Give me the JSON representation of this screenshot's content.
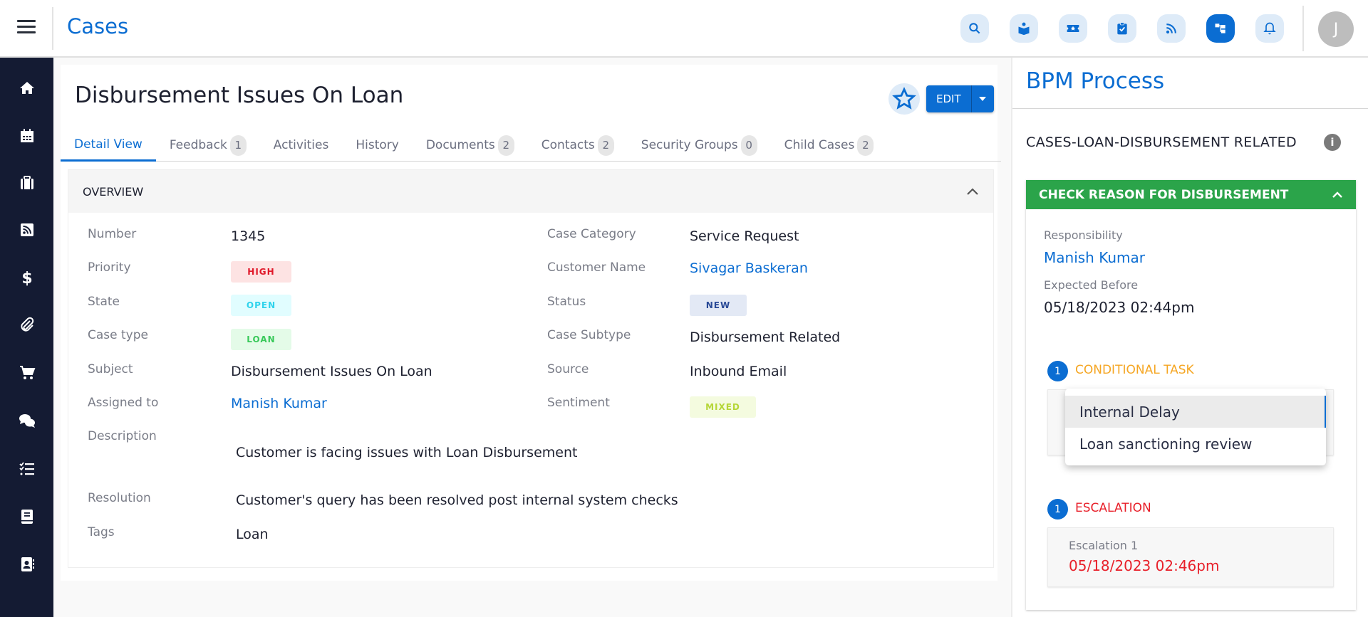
{
  "header": {
    "menu_icon": "hamburger-icon",
    "title": "Cases",
    "icons": [
      {
        "name": "search-icon",
        "active": false
      },
      {
        "name": "knowledge-base-icon",
        "active": false
      },
      {
        "name": "ticket-star-icon",
        "active": false
      },
      {
        "name": "clipboard-check-icon",
        "active": false
      },
      {
        "name": "rss-feed-icon",
        "active": false
      },
      {
        "name": "bpm-process-icon",
        "active": true
      },
      {
        "name": "bell-icon",
        "active": false
      }
    ],
    "avatar_initial": "J"
  },
  "sidebar": {
    "items": [
      {
        "name": "home-icon"
      },
      {
        "name": "calendar-icon"
      },
      {
        "name": "briefcase-icon"
      },
      {
        "name": "rss-icon"
      },
      {
        "name": "dollar-icon"
      },
      {
        "name": "paperclip-icon"
      },
      {
        "name": "cart-icon"
      },
      {
        "name": "chat-icon"
      },
      {
        "name": "checklist-icon"
      },
      {
        "name": "book-icon"
      },
      {
        "name": "contacts-icon"
      }
    ]
  },
  "case": {
    "title": "Disbursement Issues On Loan",
    "edit_label": "EDIT",
    "tabs": [
      {
        "label": "Detail View",
        "count": null,
        "active": true
      },
      {
        "label": "Feedback",
        "count": "1"
      },
      {
        "label": "Activities",
        "count": null
      },
      {
        "label": "History",
        "count": null
      },
      {
        "label": "Documents",
        "count": "2"
      },
      {
        "label": "Contacts",
        "count": "2"
      },
      {
        "label": "Security Groups",
        "count": "0"
      },
      {
        "label": "Child Cases",
        "count": "2"
      }
    ],
    "overview": {
      "title": "OVERVIEW",
      "number_label": "Number",
      "number": "1345",
      "priority_label": "Priority",
      "priority": "HIGH",
      "state_label": "State",
      "state": "OPEN",
      "case_type_label": "Case type",
      "case_type": "LOAN",
      "subject_label": "Subject",
      "subject": "Disbursement Issues On Loan",
      "assigned_label": "Assigned to",
      "assigned": "Manish Kumar",
      "category_label": "Case Category",
      "category": "Service Request",
      "customer_label": "Customer Name",
      "customer": "Sivagar Baskeran",
      "status_label": "Status",
      "status": "NEW",
      "subtype_label": "Case Subtype",
      "subtype": "Disbursement Related",
      "source_label": "Source",
      "source": "Inbound Email",
      "sentiment_label": "Sentiment",
      "sentiment": "MIXED",
      "description_label": "Description",
      "description": "Customer is facing issues with Loan Disbursement",
      "resolution_label": "Resolution",
      "resolution": "Customer's query has been resolved post internal system checks",
      "tags_label": "Tags",
      "tags": "Loan"
    }
  },
  "bpm": {
    "title": "BPM Process",
    "process_name": "CASES-LOAN-DISBURSEMENT RELATED",
    "stage_title": "CHECK REASON FOR DISBURSEMENT",
    "responsibility_label": "Responsibility",
    "responsibility": "Manish Kumar",
    "expected_label": "Expected Before",
    "expected": "05/18/2023 02:44pm",
    "conditional": {
      "count": "1",
      "title": "CONDITIONAL TASK",
      "options": [
        "Internal Delay",
        "Loan sanctioning review"
      ],
      "highlighted": "Internal Delay"
    },
    "escalation": {
      "count": "1",
      "title": "ESCALATION",
      "item_label": "Escalation 1",
      "item_time": "05/18/2023 02:46pm"
    },
    "colors": {
      "accent": "#0b6dd2",
      "stage_green": "#2ba44a",
      "conditional_orange": "#f5a623",
      "escalation_red": "#e8202a"
    }
  }
}
